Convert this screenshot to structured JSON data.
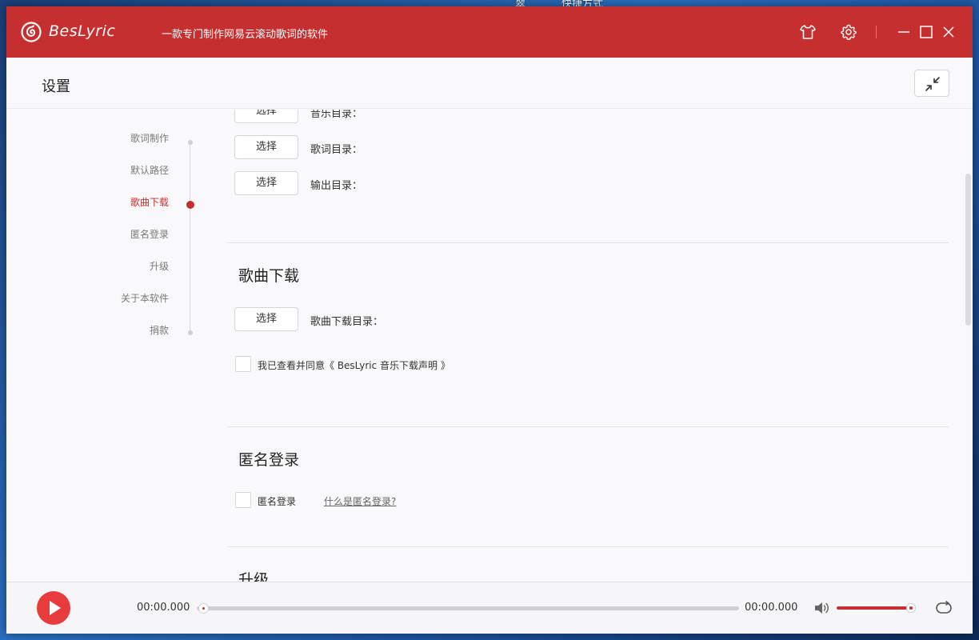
{
  "desktop": {
    "labels": [
      "翠",
      "快捷方式"
    ]
  },
  "titlebar": {
    "app_name": "BesLyric",
    "slogan": "一款专门制作网易云滚动歌词的软件",
    "icons": [
      "skin-icon",
      "gear-icon",
      "minimize-icon",
      "maximize-icon",
      "close-icon"
    ],
    "color": "#c62f2f"
  },
  "page": {
    "title": "设置"
  },
  "nav": {
    "items": [
      "歌词制作",
      "默认路径",
      "歌曲下载",
      "匿名登录",
      "升级",
      "关于本软件",
      "捐款"
    ],
    "active_index": 2
  },
  "default_paths": {
    "rows": [
      {
        "button": "选择",
        "label": "音乐目录："
      },
      {
        "button": "选择",
        "label": "歌词目录："
      },
      {
        "button": "选择",
        "label": "输出目录："
      }
    ]
  },
  "song_download": {
    "title": "歌曲下载",
    "button": "选择",
    "label": "歌曲下载目录：",
    "agree_label": "我已查看并同意《 BesLyric 音乐下载声明 》",
    "agree_checked": false
  },
  "anonymous_login": {
    "title": "匿名登录",
    "checkbox_label": "匿名登录",
    "checked": false,
    "help_link": "什么是匿名登录?"
  },
  "upgrade": {
    "title": "升级"
  },
  "player": {
    "current_time": "00:00.000",
    "total_time": "00:00.000",
    "progress": 0,
    "volume": 0.97,
    "accent": "#e83c3c"
  }
}
